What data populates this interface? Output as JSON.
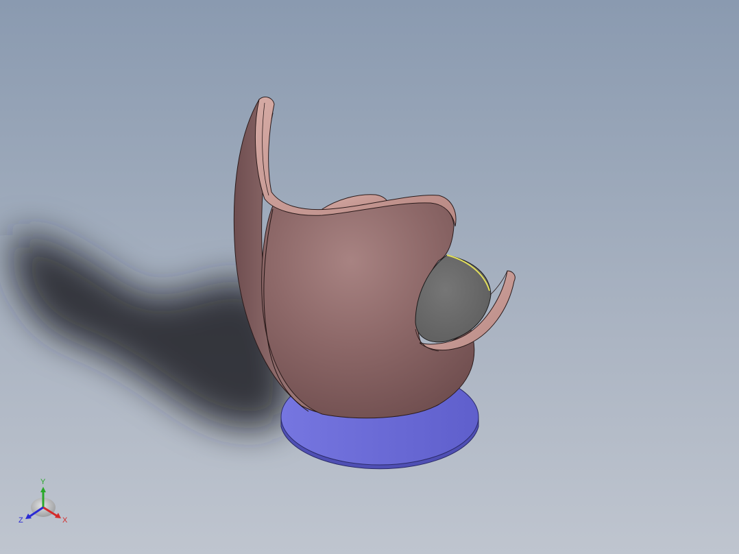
{
  "viewport": {
    "background_top": "#8a9ab0",
    "background_bottom": "#bfc5cf"
  },
  "model": {
    "shell_color": "#8c6464",
    "rim_color": "#c79a94",
    "cushion_color": "#6b6b6b",
    "seam_highlight_color": "#e3e05a",
    "base_color": "#6a6ad2"
  },
  "triad": {
    "x_label": "X",
    "y_label": "Y",
    "z_label": "Z",
    "x_color": "#d42a2a",
    "y_color": "#2aa82a",
    "z_color": "#2a2ad4"
  }
}
